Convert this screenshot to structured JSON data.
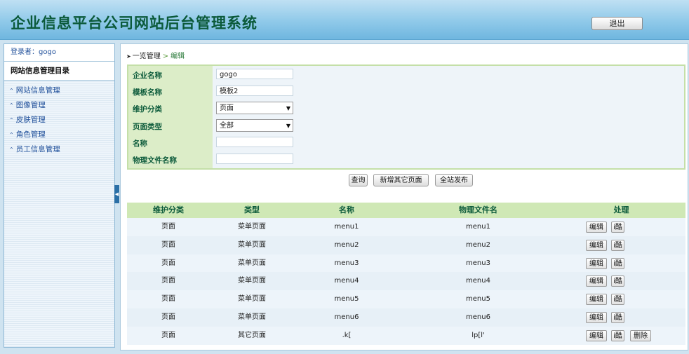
{
  "header": {
    "title": "企业信息平台公司网站后台管理系统",
    "logout_label": "退出"
  },
  "sidebar": {
    "login_text": "登录者：gogo",
    "directory_title": "网站信息管理目录",
    "items": [
      {
        "label": "网站信息管理"
      },
      {
        "label": "图像管理"
      },
      {
        "label": "皮肤管理"
      },
      {
        "label": "角色管理"
      },
      {
        "label": "员工信息管理"
      }
    ]
  },
  "breadcrumb": {
    "root": "一览管理",
    "separator": ">",
    "current": "编辑"
  },
  "form": {
    "fields": [
      {
        "label": "企业名称",
        "type": "input",
        "value": "gogo"
      },
      {
        "label": "模板名称",
        "type": "input",
        "value": "模板2"
      },
      {
        "label": "维护分类",
        "type": "select",
        "value": "页面"
      },
      {
        "label": "页面类型",
        "type": "select",
        "value": "全部"
      },
      {
        "label": "名称",
        "type": "input",
        "value": ""
      },
      {
        "label": "物理文件名称",
        "type": "input",
        "value": ""
      }
    ],
    "buttons": {
      "query": "查询",
      "add_other": "新增其它页面",
      "publish_all": "全站发布"
    }
  },
  "table": {
    "headers": [
      "维护分类",
      "类型",
      "名称",
      "物理文件名",
      "处理"
    ],
    "rows": [
      {
        "category": "页面",
        "type": "菜单页面",
        "name": "menu1",
        "file": "menu1",
        "edit": "编辑",
        "browse": "i酷",
        "delete": ""
      },
      {
        "category": "页面",
        "type": "菜单页面",
        "name": "menu2",
        "file": "menu2",
        "edit": "编辑",
        "browse": "i酷",
        "delete": ""
      },
      {
        "category": "页面",
        "type": "菜单页面",
        "name": "menu3",
        "file": "menu3",
        "edit": "编辑",
        "browse": "i酷",
        "delete": ""
      },
      {
        "category": "页面",
        "type": "菜单页面",
        "name": "menu4",
        "file": "menu4",
        "edit": "编辑",
        "browse": "i酷",
        "delete": ""
      },
      {
        "category": "页面",
        "type": "菜单页面",
        "name": "menu5",
        "file": "menu5",
        "edit": "编辑",
        "browse": "i酷",
        "delete": ""
      },
      {
        "category": "页面",
        "type": "菜单页面",
        "name": "menu6",
        "file": "menu6",
        "edit": "编辑",
        "browse": "i酷",
        "delete": ""
      },
      {
        "category": "页面",
        "type": "其它页面",
        "name": ".k[",
        "file": "lp[l'",
        "edit": "编辑",
        "browse": "i酷",
        "delete": "删除"
      }
    ]
  },
  "colors": {
    "header_top": "#bfe0f3",
    "header_bottom": "#6fb6df",
    "title_green": "#0b5a3a",
    "label_bg": "#dcedc8",
    "table_header_bg": "#cfe8b5",
    "link_blue": "#1f4f9a"
  },
  "icons": {
    "menu_chevron": "double-chevron-up-icon",
    "breadcrumb_arrow": "arrow-right-icon",
    "select_arrow": "chevron-down-icon",
    "sidebar_toggle": "collapse-left-icon"
  }
}
